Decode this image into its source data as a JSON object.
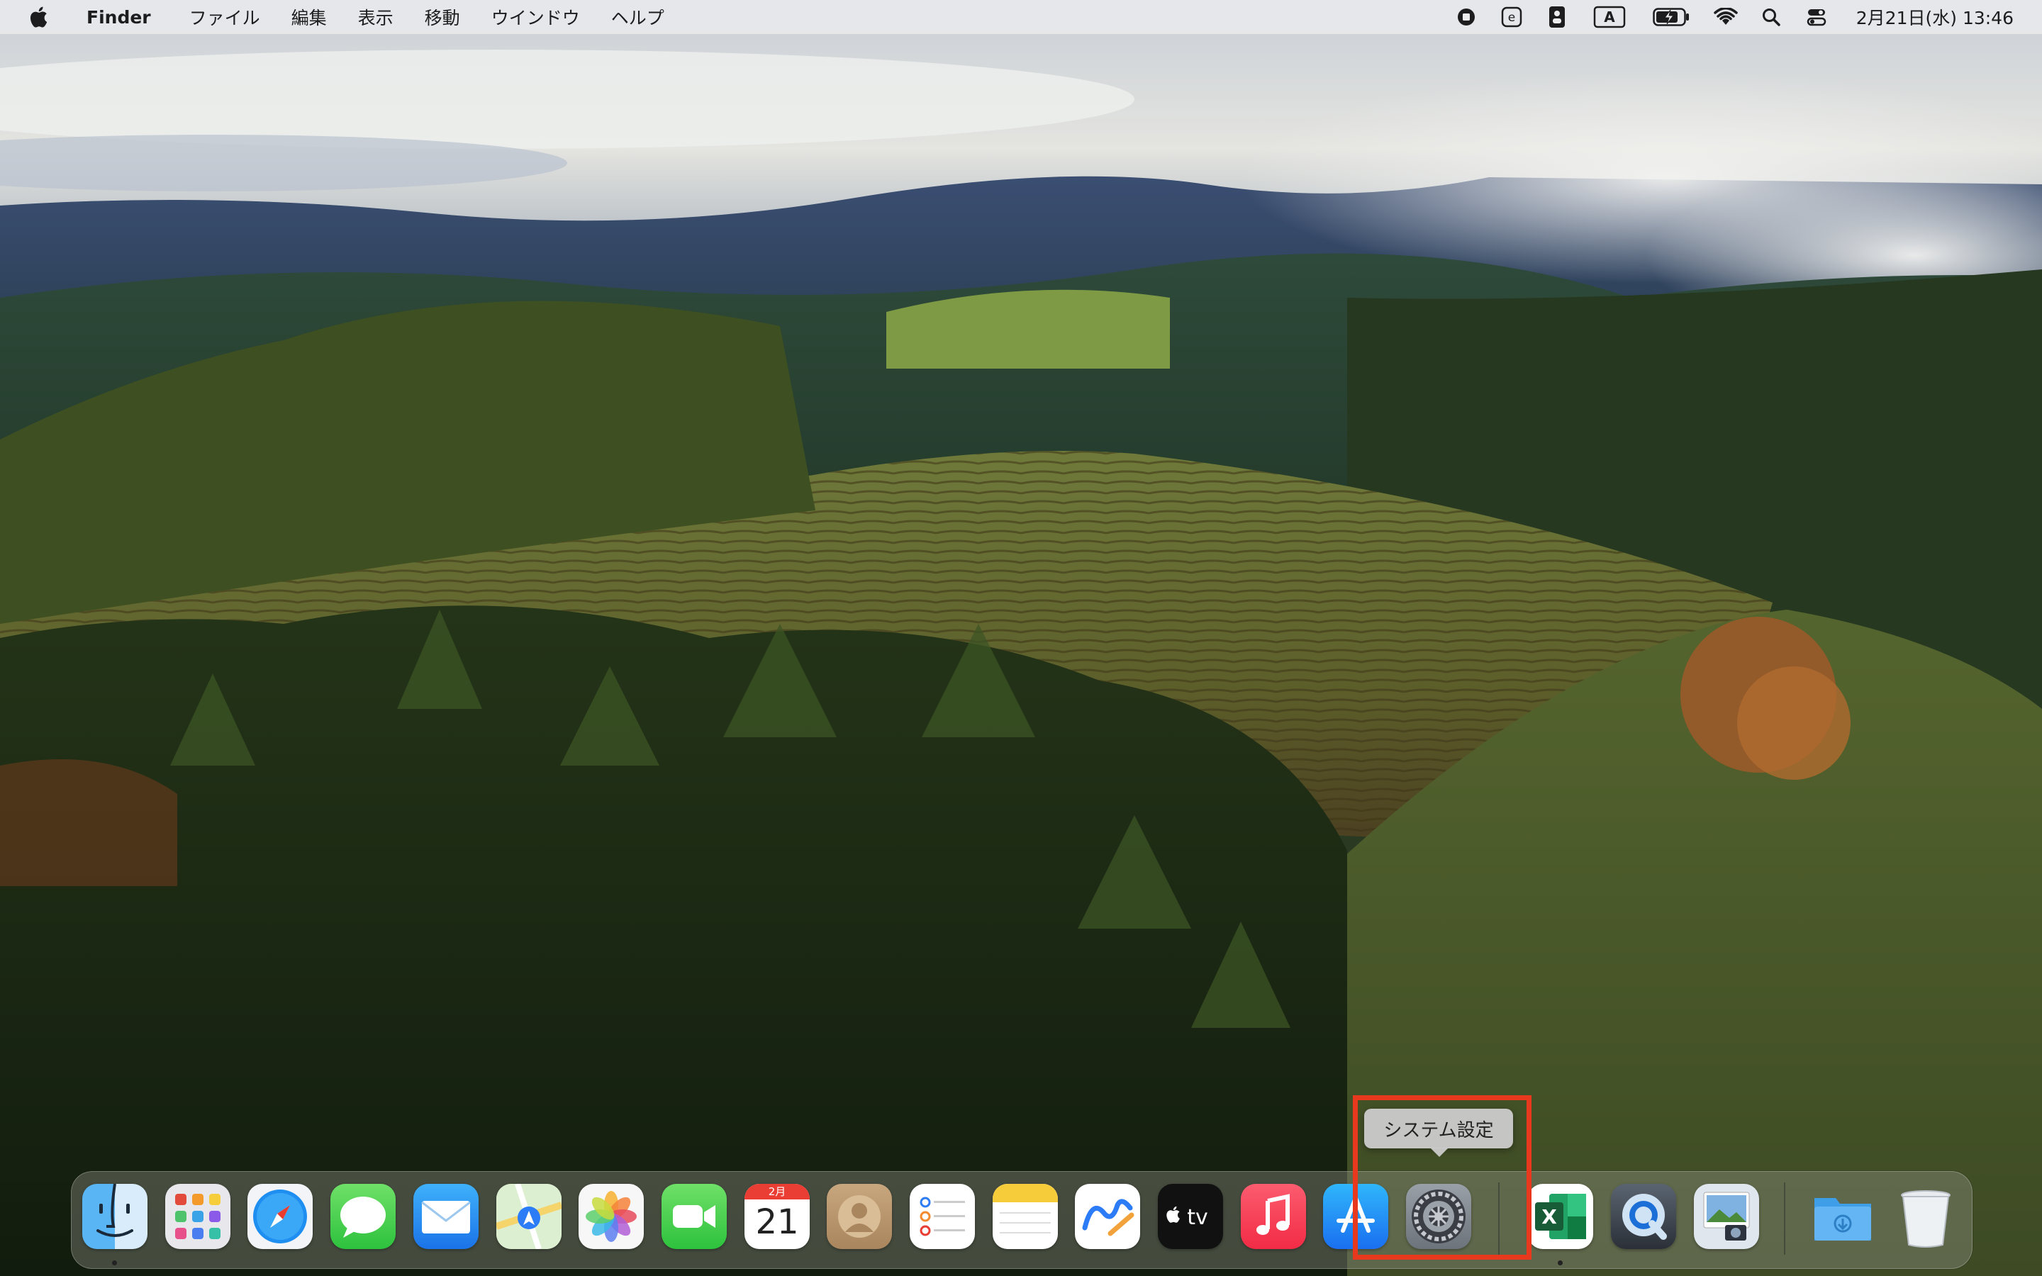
{
  "menubar": {
    "app_name": "Finder",
    "menus": [
      "ファイル",
      "編集",
      "表示",
      "移動",
      "ウインドウ",
      "ヘルプ"
    ],
    "status_icons": [
      "screen-record-stop-icon",
      "input-e-icon",
      "contacts-badge-icon",
      "input-source-a-icon",
      "battery-charging-icon",
      "wifi-icon",
      "spotlight-search-icon",
      "control-center-icon"
    ],
    "input_source_letter": "A",
    "input_e_letter": "e",
    "clock": "2月21日(水) 13:46"
  },
  "dock": {
    "apps": [
      {
        "name": "finder",
        "running": true
      },
      {
        "name": "launchpad",
        "running": false
      },
      {
        "name": "safari",
        "running": false
      },
      {
        "name": "messages",
        "running": false
      },
      {
        "name": "mail",
        "running": false
      },
      {
        "name": "maps",
        "running": false
      },
      {
        "name": "photos",
        "running": false
      },
      {
        "name": "facetime",
        "running": false
      },
      {
        "name": "calendar",
        "running": false
      },
      {
        "name": "contacts",
        "running": false
      },
      {
        "name": "reminders",
        "running": false
      },
      {
        "name": "notes",
        "running": false
      },
      {
        "name": "freeform",
        "running": false
      },
      {
        "name": "apple-tv",
        "running": false
      },
      {
        "name": "music",
        "running": false
      },
      {
        "name": "app-store",
        "running": false
      },
      {
        "name": "system-settings",
        "running": false
      },
      {
        "name": "excel",
        "running": true
      },
      {
        "name": "quicktime",
        "running": false
      },
      {
        "name": "preview",
        "running": false
      },
      {
        "name": "downloads",
        "running": false
      },
      {
        "name": "trash",
        "running": false
      }
    ],
    "calendar_month": "2月",
    "calendar_day": "21",
    "tv_label": "tv",
    "excel_letter": "X",
    "tooltip": "システム設定"
  },
  "colors": {
    "highlight": "#e8391f",
    "menubar_bg": "#ececee"
  }
}
